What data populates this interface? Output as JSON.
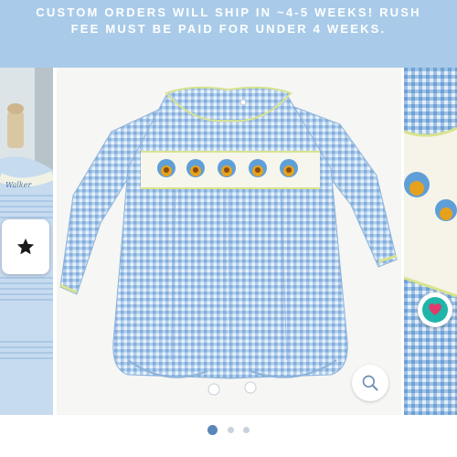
{
  "banner": {
    "line1": "CUSTOM ORDERS WILL SHIP IN ~4-5 WEEKS! RUSH",
    "line2": "FEE MUST BE PAID FOR UNDER 4 WEEKS."
  },
  "carousel": {
    "left_slide_embroidery": "Walker",
    "main_image": "smocked-blue-gingham-bubble-romper",
    "slide_count": 3,
    "active_slide": 1
  },
  "icons": {
    "star": "star-icon",
    "heart": "heart-icon",
    "zoom": "search-icon"
  },
  "colors": {
    "banner": "#a9cbe9",
    "heart_accent": "#1fb5a8",
    "dot_active": "#5b86b8",
    "dot_inactive": "#c9d2dc"
  }
}
